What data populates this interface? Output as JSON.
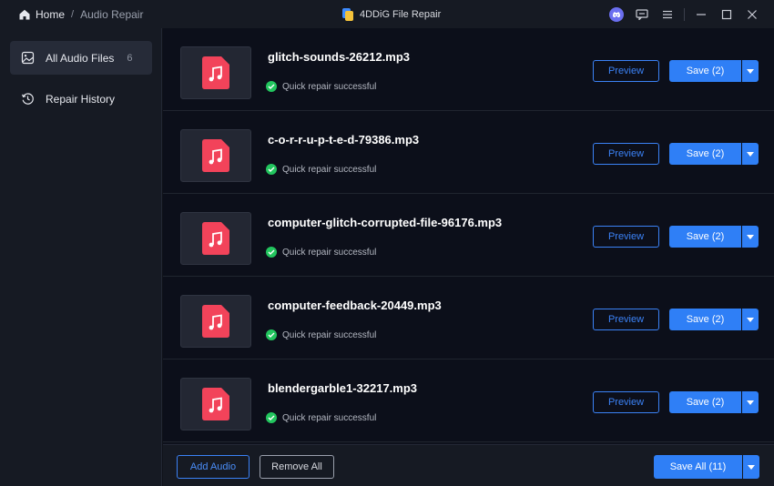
{
  "titlebar": {
    "home_label": "Home",
    "separator": "/",
    "current_label": "Audio Repair",
    "app_title": "4DDiG File Repair"
  },
  "sidebar": {
    "items": [
      {
        "label": "All Audio Files",
        "count": "6"
      },
      {
        "label": "Repair History"
      }
    ]
  },
  "files": [
    {
      "name": "glitch-sounds-26212.mp3",
      "status": "Quick repair successful",
      "preview_label": "Preview",
      "save_label": "Save (2)"
    },
    {
      "name": "c-o-r-r-u-p-t-e-d-79386.mp3",
      "status": "Quick repair successful",
      "preview_label": "Preview",
      "save_label": "Save (2)"
    },
    {
      "name": "computer-glitch-corrupted-file-96176.mp3",
      "status": "Quick repair successful",
      "preview_label": "Preview",
      "save_label": "Save (2)"
    },
    {
      "name": "computer-feedback-20449.mp3",
      "status": "Quick repair successful",
      "preview_label": "Preview",
      "save_label": "Save (2)"
    },
    {
      "name": "blendergarble1-32217.mp3",
      "status": "Quick repair successful",
      "preview_label": "Preview",
      "save_label": "Save (2)"
    }
  ],
  "bottombar": {
    "add_label": "Add Audio",
    "remove_label": "Remove All",
    "save_all_label": "Save All (11)"
  },
  "colors": {
    "accent": "#2f7ff6",
    "file_icon": "#f2435a",
    "success": "#22c55e"
  }
}
